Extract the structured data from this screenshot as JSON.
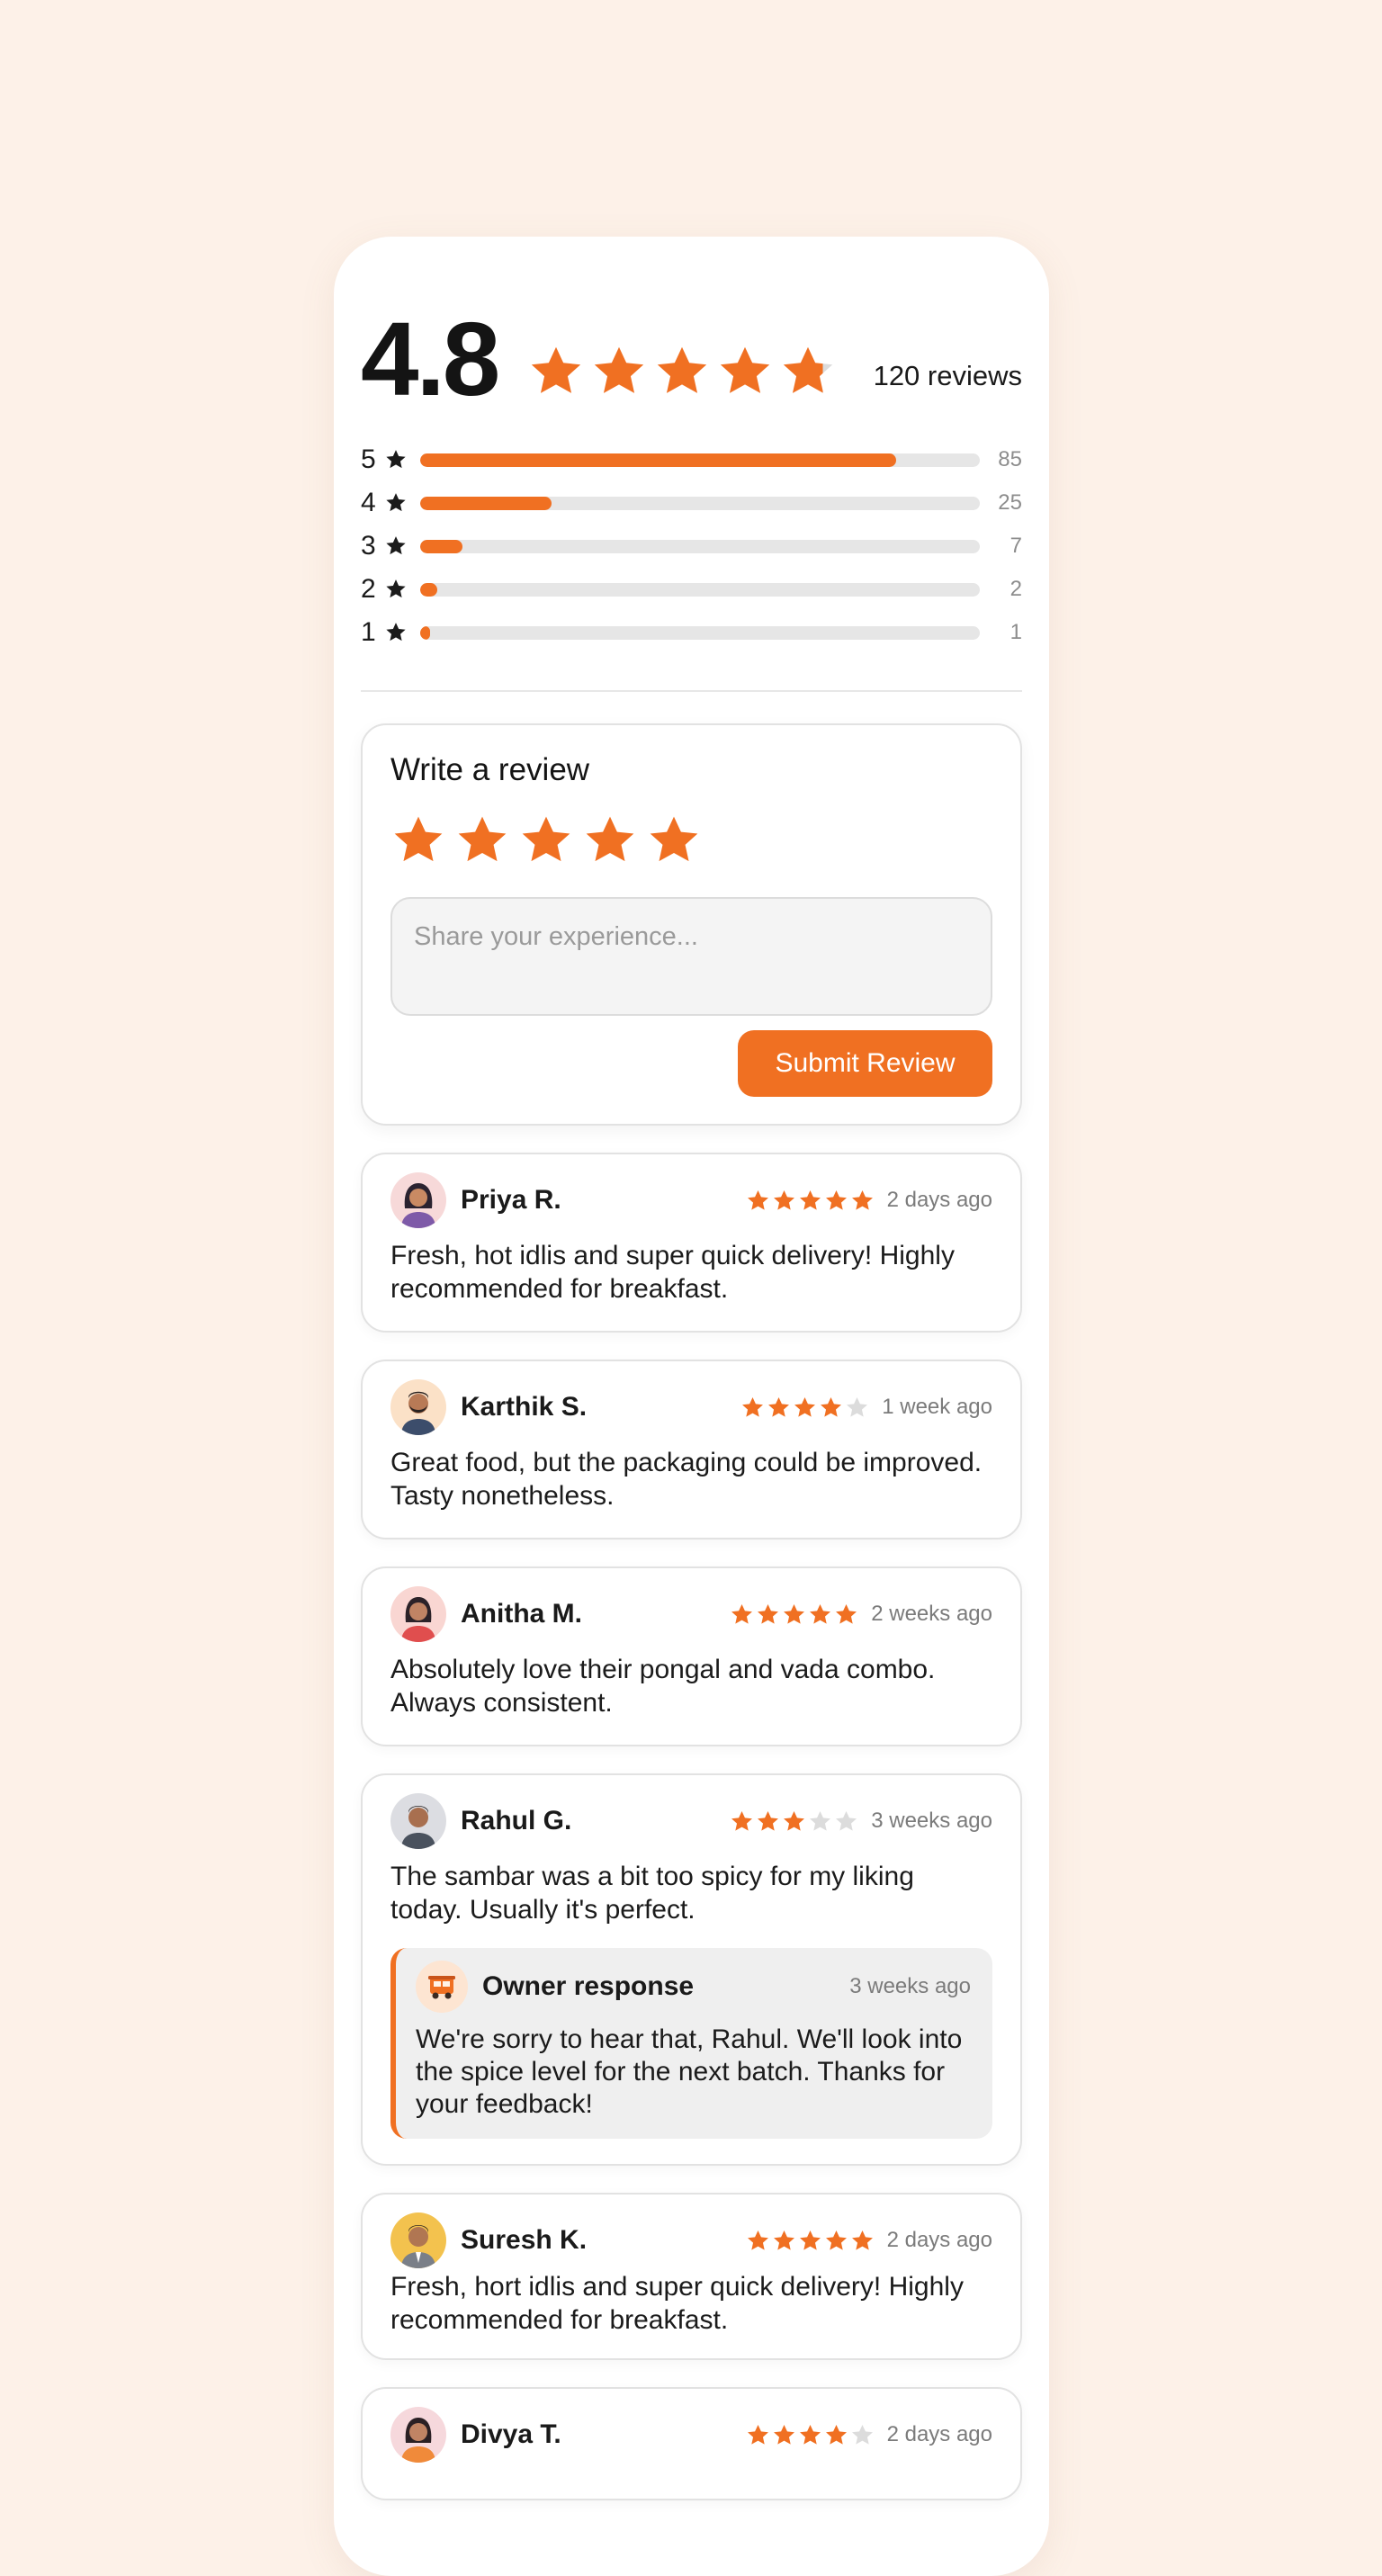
{
  "summary": {
    "average": "4.8",
    "average_value": 4.8,
    "review_count": "120 reviews",
    "distribution": [
      {
        "stars": "5",
        "count": "85",
        "fraction": 0.85
      },
      {
        "stars": "4",
        "count": "25",
        "fraction": 0.235
      },
      {
        "stars": "3",
        "count": "7",
        "fraction": 0.075
      },
      {
        "stars": "2",
        "count": "2",
        "fraction": 0.03
      },
      {
        "stars": "1",
        "count": "1",
        "fraction": 0.017
      }
    ]
  },
  "write_review": {
    "title": "Write a review",
    "selected_stars": 5,
    "placeholder": "Share your experience...",
    "submit_label": "Submit Review"
  },
  "reviews": [
    {
      "name": "Priya R.",
      "rating": 5,
      "date": "2 days ago",
      "avatar": "woman-avatar-icon",
      "text": "Fresh, hot idlis and super quick delivery! Highly recommended for breakfast."
    },
    {
      "name": "Karthik S.",
      "rating": 4,
      "date": "1 week ago",
      "avatar": "bearded-man-avatar-icon",
      "text": "Great food, but the packaging could be improved. Tasty nonetheless."
    },
    {
      "name": "Anitha M.",
      "rating": 5,
      "date": "2 weeks ago",
      "avatar": "woman-avatar-icon",
      "text": "Absolutely love their pongal and vada combo. Always consistent."
    },
    {
      "name": "Rahul G.",
      "rating": 3,
      "date": "3 weeks ago",
      "avatar": "man-avatar-icon",
      "text": "The sambar was a bit too spicy for my liking today. Usually it's perfect.",
      "owner_response": {
        "title": "Owner response",
        "date": "3 weeks ago",
        "icon": "food-truck-icon",
        "text": "We're sorry to hear that, Rahul. We'll look into the spice level for the next batch. Thanks for your feedback!"
      }
    },
    {
      "name": "Suresh K.",
      "rating": 5,
      "date": "2 days ago",
      "avatar": "man-avatar-icon",
      "text": "Fresh, hort idlis and super quick delivery! Highly recommended for breakfast."
    },
    {
      "name": "Divya T.",
      "rating": 4,
      "date": "2 days ago",
      "avatar": "woman-avatar-icon",
      "text": ""
    }
  ],
  "colors": {
    "accent": "#f07022",
    "background": "#fdf1e8",
    "star_empty": "#dcdcdc"
  }
}
